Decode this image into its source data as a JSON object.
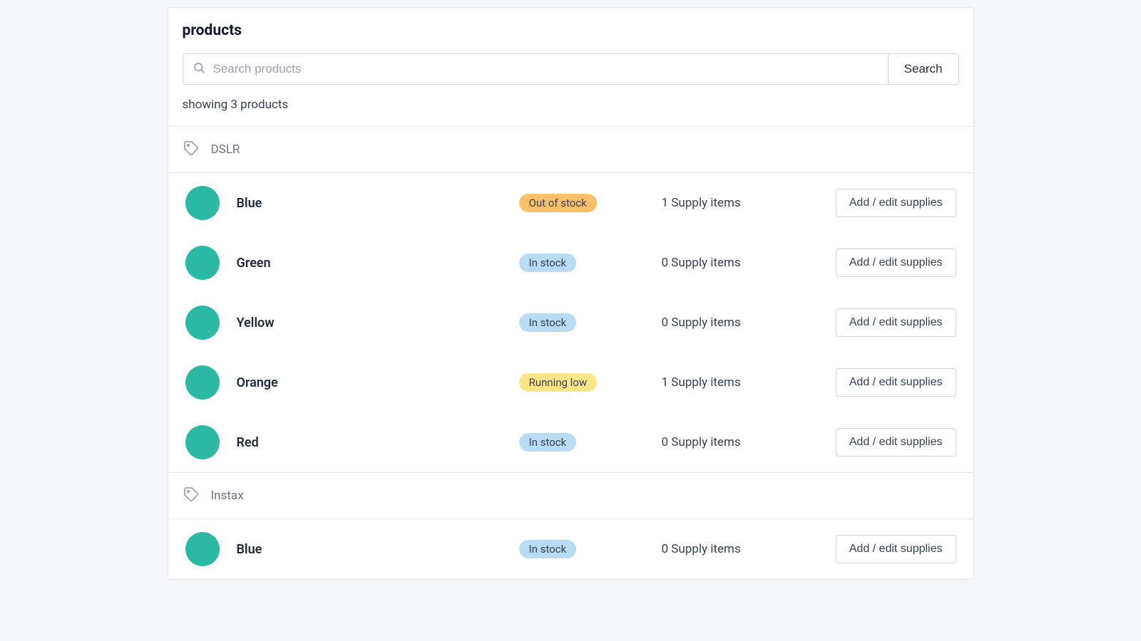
{
  "title": "products",
  "search": {
    "placeholder": "Search products",
    "button": "Search"
  },
  "summary": "showing 3 products",
  "action_button": "Add / edit supplies",
  "status_labels": {
    "out": "Out of stock",
    "in": "In stock",
    "low": "Running low"
  },
  "groups": [
    {
      "label": "DSLR",
      "rows": [
        {
          "name": "Blue",
          "status": "out",
          "supply": "1 Supply items"
        },
        {
          "name": "Green",
          "status": "in",
          "supply": "0 Supply items"
        },
        {
          "name": "Yellow",
          "status": "in",
          "supply": "0 Supply items"
        },
        {
          "name": "Orange",
          "status": "low",
          "supply": "1 Supply items"
        },
        {
          "name": "Red",
          "status": "in",
          "supply": "0 Supply items"
        }
      ]
    },
    {
      "label": "Instax",
      "rows": [
        {
          "name": "Blue",
          "status": "in",
          "supply": "0 Supply items"
        }
      ]
    }
  ]
}
